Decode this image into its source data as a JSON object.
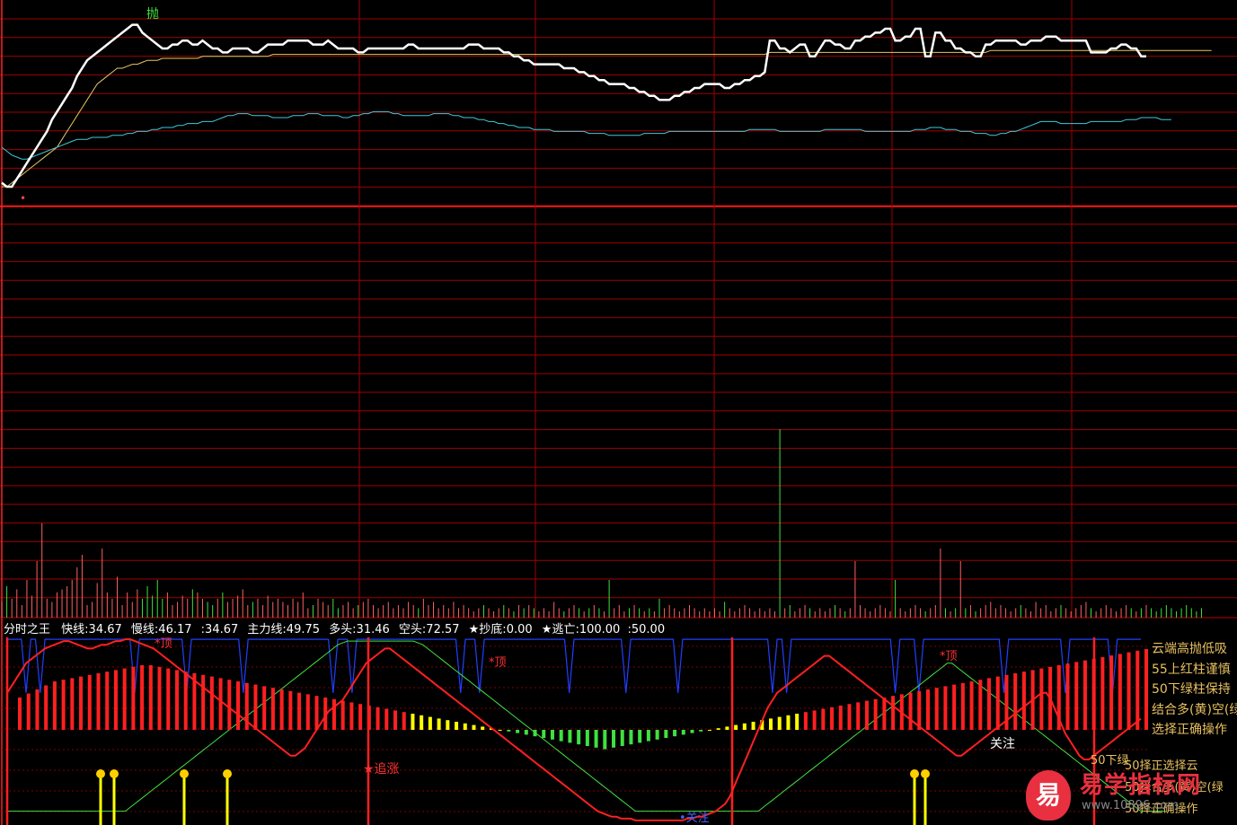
{
  "colors": {
    "background": "#000000",
    "grid": "#a00000",
    "price": "#ffffff",
    "avg": "#e8c860",
    "cyan": "#40c8d8",
    "vol_red": "#ff6060",
    "vol_green": "#40e040",
    "osc_red": "#ff2020",
    "osc_green": "#40e040",
    "osc_blue": "#2040ff",
    "osc_yellow": "#ffff00",
    "text": "#ffffff",
    "side_text": "#e8c060"
  },
  "header": {
    "title": "分时之王",
    "items": [
      {
        "label": "快线:",
        "value": "34.67"
      },
      {
        "label": "慢线:",
        "value": "46.17"
      },
      {
        "label": ":",
        "value": "34.67"
      },
      {
        "label": "主力线:",
        "value": "49.75"
      },
      {
        "label": "多头:",
        "value": "31.46"
      },
      {
        "label": "空头:",
        "value": "72.57"
      },
      {
        "label": "★抄底:",
        "value": "0.00"
      },
      {
        "label": "★逃亡:",
        "value": "100.00"
      },
      {
        "label": ":",
        "value": "50.00"
      }
    ]
  },
  "markers": {
    "sell": "抛",
    "buy": "顶"
  },
  "osc_labels": {
    "top1": "*顶",
    "top2": "*顶",
    "top3": "*顶",
    "chase": "★追涨",
    "focus": "关注",
    "bottom": "•关注"
  },
  "side_notes": [
    "云端高抛低吸",
    "55上红柱谨慎",
    "50下绿柱保持",
    "结合多(黄)空(绿",
    "选择正确操作",
    "50下绿",
    "50择正选择云",
    "50择合多(黄)空(绿",
    "50择正确操作"
  ],
  "watermark": {
    "icon": "易",
    "text": "易学指标网",
    "url": "www.10896.com"
  },
  "chart_data": {
    "type": "line",
    "points": 241,
    "price_range": [
      0,
      100
    ],
    "osc_range": [
      0,
      100
    ],
    "price": [
      12,
      10,
      10,
      14,
      18,
      22,
      26,
      30,
      34,
      38,
      44,
      48,
      52,
      56,
      60,
      66,
      70,
      74,
      76,
      78,
      80,
      82,
      84,
      86,
      88,
      90,
      92,
      92,
      88,
      86,
      84,
      82,
      80,
      80,
      82,
      82,
      84,
      84,
      82,
      82,
      84,
      82,
      80,
      80,
      78,
      78,
      80,
      80,
      80,
      80,
      78,
      78,
      80,
      82,
      82,
      82,
      82,
      84,
      84,
      84,
      84,
      84,
      82,
      82,
      82,
      84,
      82,
      80,
      80,
      80,
      80,
      78,
      78,
      80,
      80,
      80,
      80,
      80,
      80,
      80,
      80,
      82,
      82,
      80,
      80,
      80,
      80,
      80,
      80,
      80,
      80,
      80,
      80,
      82,
      82,
      82,
      80,
      80,
      80,
      80,
      78,
      78,
      76,
      76,
      74,
      74,
      72,
      72,
      72,
      72,
      72,
      72,
      70,
      70,
      70,
      68,
      68,
      66,
      66,
      64,
      64,
      62,
      62,
      62,
      62,
      60,
      60,
      58,
      58,
      56,
      56,
      54,
      54,
      54,
      56,
      56,
      58,
      58,
      60,
      60,
      62,
      62,
      62,
      62,
      60,
      60,
      62,
      62,
      64,
      64,
      66,
      66,
      68,
      84,
      84,
      80,
      80,
      78,
      80,
      82,
      82,
      76,
      76,
      80,
      84,
      84,
      82,
      82,
      80,
      80,
      84,
      84,
      86,
      86,
      88,
      88,
      90,
      90,
      84,
      84,
      86,
      86,
      90,
      90,
      76,
      76,
      88,
      88,
      84,
      84,
      80,
      80,
      78,
      78,
      76,
      76,
      82,
      82,
      84,
      84,
      84,
      84,
      84,
      82,
      82,
      84,
      84,
      84,
      86,
      86,
      86,
      84,
      84,
      84,
      84,
      84,
      84,
      78,
      78,
      78,
      78,
      80,
      80,
      82,
      82,
      80,
      80,
      76,
      76
    ],
    "avg": [
      10,
      10,
      12,
      14,
      16,
      18,
      20,
      22,
      24,
      26,
      28,
      30,
      34,
      38,
      42,
      46,
      50,
      54,
      58,
      62,
      64,
      66,
      68,
      70,
      70,
      71,
      72,
      72,
      73,
      74,
      74,
      74,
      75,
      75,
      75,
      75,
      75,
      75,
      75,
      75,
      76,
      76,
      76,
      76,
      76,
      76,
      76,
      76,
      76,
      76,
      76,
      76,
      76,
      76,
      77,
      77,
      77,
      77,
      77,
      77,
      77,
      77,
      77,
      77,
      77,
      77,
      77,
      77,
      77,
      77,
      77,
      77,
      77,
      77,
      77,
      77,
      77,
      77,
      77,
      77,
      77,
      77,
      77,
      77,
      77,
      77,
      77,
      77,
      77,
      77,
      77,
      77,
      77,
      77,
      77,
      77,
      77,
      77,
      77,
      77,
      77,
      77,
      77,
      77,
      77,
      77,
      77,
      77,
      77,
      77,
      77,
      77,
      77,
      77,
      77,
      77,
      77,
      77,
      77,
      77,
      77,
      77,
      77,
      77,
      77,
      77,
      77,
      77,
      77,
      77,
      77,
      77,
      77,
      77,
      77,
      77,
      77,
      77,
      77,
      77,
      77,
      77,
      77,
      77,
      77,
      77,
      77,
      77,
      77,
      77,
      77,
      77,
      77,
      78,
      78,
      78,
      78,
      78,
      78,
      78,
      78,
      78,
      78,
      78,
      78,
      78,
      78,
      78,
      78,
      78,
      78,
      78,
      78,
      78,
      78,
      78,
      78,
      78,
      78,
      78,
      78,
      78,
      78,
      78,
      78,
      78,
      78,
      78,
      78,
      78,
      78,
      78,
      78,
      78,
      78,
      78,
      78,
      79,
      79,
      79,
      79,
      79,
      79,
      79,
      79,
      79,
      79,
      79,
      79,
      79,
      79,
      79,
      79,
      79,
      79,
      79,
      79,
      79,
      79,
      79,
      79,
      79,
      79,
      79,
      79,
      79,
      79,
      79,
      79,
      79,
      79,
      79,
      79,
      79,
      79,
      79,
      79,
      79,
      79,
      79,
      79,
      79
    ],
    "cyan": [
      30,
      28,
      26,
      25,
      24,
      24,
      25,
      26,
      27,
      28,
      29,
      30,
      31,
      32,
      33,
      34,
      34,
      34,
      35,
      35,
      35,
      35,
      36,
      36,
      36,
      37,
      37,
      38,
      38,
      38,
      39,
      39,
      40,
      40,
      40,
      41,
      41,
      42,
      42,
      42,
      43,
      43,
      43,
      44,
      45,
      46,
      46,
      47,
      47,
      47,
      46,
      46,
      46,
      46,
      45,
      45,
      45,
      45,
      46,
      46,
      46,
      47,
      47,
      47,
      46,
      46,
      46,
      46,
      45,
      45,
      46,
      46,
      47,
      47,
      48,
      48,
      48,
      48,
      47,
      47,
      46,
      46,
      46,
      46,
      46,
      46,
      47,
      47,
      47,
      47,
      46,
      46,
      45,
      45,
      45,
      44,
      44,
      43,
      43,
      42,
      42,
      41,
      41,
      40,
      40,
      40,
      39,
      39,
      39,
      39,
      38,
      38,
      38,
      38,
      38,
      38,
      38,
      37,
      37,
      37,
      37,
      36,
      36,
      36,
      36,
      36,
      36,
      36,
      37,
      37,
      37,
      37,
      37,
      38,
      38,
      38,
      38,
      38,
      38,
      38,
      38,
      38,
      38,
      38,
      38,
      38,
      38,
      38,
      38,
      39,
      39,
      39,
      39,
      39,
      39,
      38,
      38,
      38,
      38,
      38,
      38,
      38,
      38,
      38,
      39,
      39,
      39,
      39,
      39,
      39,
      39,
      39,
      38,
      38,
      38,
      38,
      38,
      38,
      38,
      38,
      38,
      38,
      39,
      39,
      39,
      40,
      40,
      40,
      39,
      39,
      39,
      38,
      38,
      38,
      37,
      37,
      37,
      36,
      36,
      37,
      37,
      38,
      38,
      39,
      40,
      41,
      42,
      43,
      43,
      43,
      43,
      42,
      42,
      42,
      42,
      42,
      42,
      43,
      43,
      43,
      43,
      43,
      43,
      43,
      44,
      44,
      44,
      45,
      45,
      45,
      45,
      44,
      44,
      44
    ],
    "volume": [
      5,
      10,
      6,
      9,
      4,
      12,
      7,
      18,
      30,
      6,
      5,
      8,
      9,
      10,
      12,
      16,
      20,
      4,
      5,
      11,
      22,
      8,
      6,
      13,
      4,
      8,
      5,
      9,
      6,
      10,
      7,
      12,
      6,
      8,
      4,
      5,
      7,
      6,
      9,
      8,
      6,
      5,
      4,
      6,
      8,
      5,
      6,
      7,
      9,
      4,
      5,
      6,
      4,
      7,
      5,
      6,
      5,
      4,
      6,
      5,
      8,
      3,
      4,
      6,
      5,
      4,
      6,
      3,
      4,
      5,
      3,
      4,
      5,
      6,
      4,
      3,
      4,
      5,
      3,
      4,
      3,
      5,
      4,
      3,
      6,
      4,
      5,
      3,
      4,
      3,
      5,
      3,
      4,
      3,
      2,
      3,
      4,
      3,
      2,
      3,
      4,
      3,
      2,
      4,
      3,
      4,
      3,
      2,
      3,
      2,
      5,
      3,
      2,
      3,
      4,
      3,
      2,
      3,
      4,
      3,
      2,
      12,
      3,
      4,
      2,
      3,
      4,
      3,
      2,
      3,
      2,
      6,
      3,
      4,
      3,
      2,
      3,
      4,
      3,
      2,
      3,
      2,
      3,
      2,
      5,
      3,
      2,
      3,
      4,
      3,
      2,
      3,
      2,
      3,
      2,
      60,
      3,
      4,
      2,
      3,
      4,
      3,
      2,
      3,
      2,
      3,
      4,
      3,
      2,
      3,
      18,
      4,
      3,
      2,
      3,
      4,
      3,
      2,
      12,
      3,
      2,
      3,
      4,
      3,
      2,
      3,
      4,
      22,
      3,
      2,
      3,
      18,
      3,
      4,
      2,
      3,
      4,
      5,
      3,
      4,
      3,
      2,
      3,
      4,
      3,
      2,
      5,
      3,
      4,
      2,
      3,
      4,
      3,
      2,
      3,
      4,
      5,
      3,
      2,
      3,
      4,
      3,
      2,
      3,
      4,
      3,
      2,
      3,
      4,
      3,
      2,
      3,
      4,
      3,
      2,
      3,
      4,
      3,
      2,
      3
    ],
    "osc_red": [
      70,
      74,
      78,
      82,
      86,
      88,
      90,
      92,
      94,
      95,
      96,
      97,
      98,
      98,
      97,
      96,
      95,
      94,
      94,
      95,
      96,
      96,
      97,
      98,
      98,
      99,
      99,
      98,
      97,
      96,
      95,
      94,
      92,
      90,
      88,
      86,
      84,
      82,
      80,
      78,
      76,
      74,
      72,
      70,
      68,
      66,
      64,
      62,
      60,
      58,
      56,
      54,
      52,
      50,
      48,
      46,
      44,
      42,
      40,
      38,
      36,
      36,
      38,
      40,
      44,
      48,
      52,
      56,
      60,
      62,
      64,
      66,
      70,
      74,
      78,
      82,
      86,
      88,
      90,
      92,
      94,
      94,
      92,
      90,
      88,
      86,
      84,
      82,
      80,
      78,
      76,
      74,
      72,
      70,
      68,
      66,
      64,
      62,
      60,
      58,
      56,
      54,
      52,
      50,
      48,
      46,
      44,
      42,
      40,
      38,
      36,
      34,
      32,
      30,
      28,
      26,
      24,
      22,
      20,
      18,
      16,
      14,
      12,
      10,
      8,
      6,
      5,
      4,
      3,
      3,
      2,
      2,
      2,
      1,
      1,
      1,
      1,
      1,
      1,
      1,
      1,
      1,
      1,
      1,
      2,
      2,
      3,
      3,
      4,
      5,
      6,
      8,
      10,
      14,
      20,
      26,
      32,
      38,
      44,
      50,
      56,
      62,
      66,
      70,
      72,
      74,
      76,
      78,
      80,
      82,
      84,
      86,
      88,
      90,
      90,
      88,
      86,
      84,
      82,
      80,
      78,
      76,
      74,
      72,
      70,
      68,
      66,
      64,
      62,
      60,
      58,
      56,
      54,
      52,
      50,
      48,
      46,
      44,
      42,
      40,
      38,
      36,
      36,
      38,
      40,
      42,
      44,
      46,
      48,
      50,
      52,
      54,
      56,
      58,
      60,
      62,
      64,
      66,
      68,
      70,
      70,
      66,
      60,
      54,
      48,
      44,
      40,
      36,
      34,
      34,
      36,
      38,
      40,
      42,
      44,
      46,
      48,
      50,
      52,
      54,
      56
    ],
    "osc_green": [
      6,
      6,
      6,
      6,
      6,
      6,
      6,
      6,
      6,
      6,
      6,
      6,
      6,
      6,
      6,
      6,
      6,
      6,
      6,
      6,
      6,
      6,
      6,
      6,
      6,
      6,
      8,
      10,
      12,
      14,
      16,
      18,
      20,
      22,
      24,
      26,
      28,
      30,
      32,
      34,
      36,
      38,
      40,
      42,
      44,
      46,
      48,
      50,
      52,
      54,
      56,
      58,
      60,
      62,
      64,
      66,
      68,
      70,
      72,
      74,
      76,
      78,
      80,
      82,
      84,
      86,
      88,
      90,
      92,
      94,
      96,
      97,
      98,
      98,
      98,
      98,
      98,
      98,
      98,
      98,
      98,
      98,
      98,
      98,
      98,
      98,
      98,
      97,
      96,
      94,
      92,
      90,
      88,
      86,
      84,
      82,
      80,
      78,
      76,
      74,
      72,
      70,
      68,
      66,
      64,
      62,
      60,
      58,
      56,
      54,
      52,
      50,
      48,
      46,
      44,
      42,
      40,
      38,
      36,
      34,
      32,
      30,
      28,
      26,
      24,
      22,
      20,
      18,
      16,
      14,
      12,
      10,
      8,
      6,
      6,
      6,
      6,
      6,
      6,
      6,
      6,
      6,
      6,
      6,
      6,
      6,
      6,
      6,
      6,
      6,
      6,
      6,
      6,
      6,
      6,
      6,
      6,
      6,
      6,
      6,
      8,
      10,
      12,
      14,
      16,
      18,
      20,
      22,
      24,
      26,
      28,
      30,
      32,
      34,
      36,
      38,
      40,
      42,
      44,
      46,
      48,
      50,
      52,
      54,
      56,
      58,
      60,
      62,
      64,
      66,
      68,
      70,
      72,
      74,
      76,
      78,
      80,
      82,
      84,
      86,
      86,
      84,
      82,
      80,
      78,
      76,
      74,
      72,
      70,
      68,
      66,
      64,
      62,
      60,
      58,
      56,
      54,
      52,
      50,
      48,
      46,
      44,
      42,
      40,
      38,
      36,
      34,
      32,
      30,
      28,
      26,
      24,
      22,
      20,
      18,
      16,
      14,
      12,
      10,
      8,
      6,
      6,
      6,
      6,
      6,
      6
    ],
    "osc_bars": [
      40,
      45,
      50,
      55,
      60,
      62,
      64,
      66,
      68,
      70,
      72,
      74,
      76,
      78,
      80,
      80,
      78,
      76,
      74,
      72,
      70,
      68,
      66,
      64,
      62,
      60,
      58,
      56,
      54,
      52,
      50,
      48,
      46,
      44,
      42,
      40,
      38,
      36,
      34,
      32,
      30,
      28,
      26,
      24,
      22,
      20,
      18,
      16,
      14,
      12,
      10,
      8,
      6,
      4,
      2,
      0,
      -2,
      -4,
      -6,
      -8,
      -10,
      -12,
      -14,
      -16,
      -18,
      -20,
      -22,
      -24,
      -22,
      -20,
      -18,
      -16,
      -14,
      -12,
      -10,
      -8,
      -6,
      -4,
      -2,
      0,
      2,
      4,
      6,
      8,
      10,
      12,
      14,
      16,
      18,
      20,
      22,
      24,
      26,
      28,
      30,
      32,
      34,
      36,
      38,
      40,
      42,
      44,
      46,
      48,
      50,
      52,
      54,
      56,
      58,
      60,
      62,
      64,
      66,
      68,
      70,
      72,
      74,
      76,
      78,
      80,
      82,
      84,
      86,
      88,
      90,
      92,
      94,
      96,
      98,
      100
    ]
  }
}
